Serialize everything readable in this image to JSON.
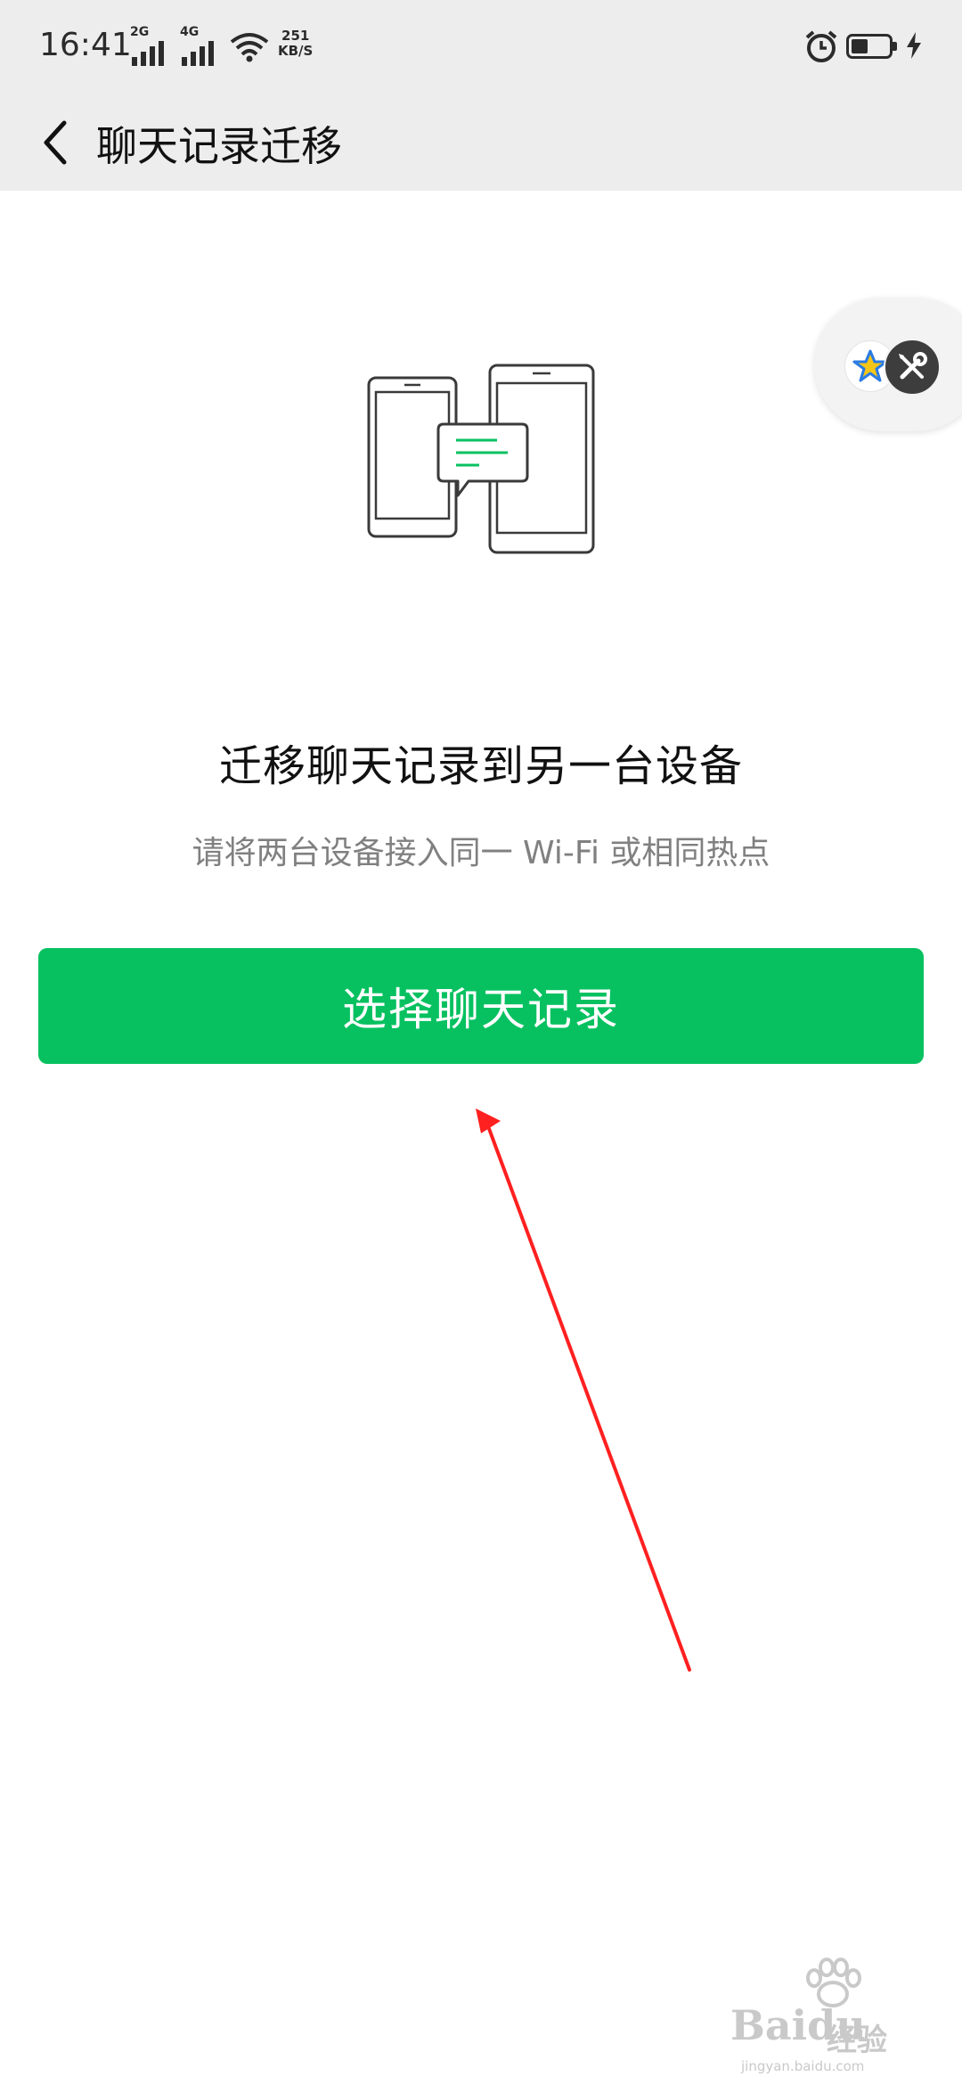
{
  "status_bar": {
    "time": "16:41",
    "signal1_tag": "2G",
    "signal2_tag": "4G",
    "speed_value": "251",
    "speed_unit": "KB/S"
  },
  "nav": {
    "title": "聊天记录迁移"
  },
  "content": {
    "heading": "迁移聊天记录到另一台设备",
    "subtext": "请将两台设备接入同一 Wi-Fi 或相同热点",
    "button_label": "选择聊天记录"
  },
  "watermark": {
    "brand": "Baidu",
    "sub": "经验",
    "url": "jingyan.baidu.com"
  },
  "colors": {
    "primary_green": "#07c160",
    "nav_bg": "#ededed",
    "annotation_red": "#ff2020"
  },
  "icons": [
    "back-arrow-icon",
    "phones-transfer-icon",
    "chat-bubble-icon",
    "star-icon",
    "tools-icon",
    "alarm-icon",
    "battery-icon",
    "charging-icon",
    "wifi-icon"
  ]
}
